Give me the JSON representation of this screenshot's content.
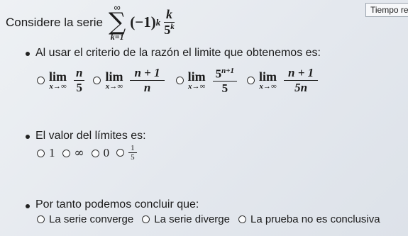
{
  "timer": {
    "label": "Tiempo re"
  },
  "question": {
    "prompt": "Considere la serie",
    "sum_upper": "∞",
    "sum_lower": "k=1",
    "term_base": "(−1)",
    "term_exp": "k",
    "frac_num": "k",
    "frac_den_base": "5",
    "frac_den_exp": "k"
  },
  "section1": {
    "heading": "Al usar el criterio de la razón el limite que obtenemos es:",
    "lim_word": "lim",
    "lim_sub": "x→∞",
    "options": [
      {
        "num": "n",
        "den": "5"
      },
      {
        "num": "n + 1",
        "den": "n"
      },
      {
        "num_base": "5",
        "num_exp": "n+1",
        "den": "5"
      },
      {
        "num": "n + 1",
        "den": "5n"
      }
    ]
  },
  "section2": {
    "heading": "El valor del límites es:",
    "options": [
      "1",
      "∞",
      "0"
    ],
    "frac_option": {
      "num": "1",
      "den": "5"
    }
  },
  "section3": {
    "heading": "Por tanto podemos concluir que:",
    "options": [
      "La serie converge",
      "La serie diverge",
      "La prueba no es conclusiva"
    ]
  }
}
